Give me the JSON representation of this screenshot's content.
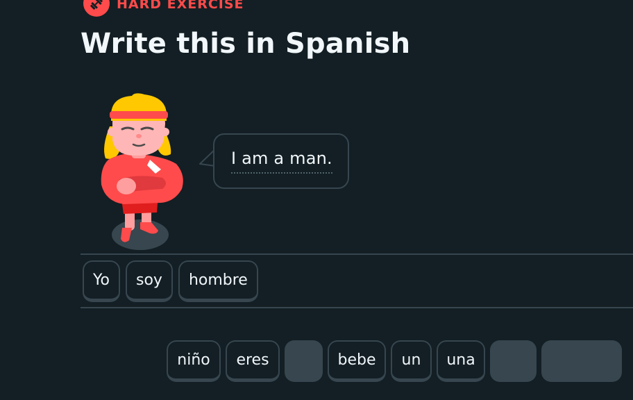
{
  "header": {
    "badge_label": "HARD EXERCISE",
    "badge_icon": "dumbbell-icon",
    "title": "Write this in Spanish"
  },
  "prompt": {
    "sentence": "I am a man."
  },
  "answer": {
    "words": [
      "Yo",
      "soy",
      "hombre"
    ]
  },
  "word_bank": {
    "words": [
      "niño",
      "eres",
      "",
      "bebe",
      "un",
      "una",
      "",
      ""
    ]
  },
  "colors": {
    "background": "#131f24",
    "accent_red": "#ff4b4b",
    "border": "#37464f",
    "text": "#f1f7fb"
  }
}
